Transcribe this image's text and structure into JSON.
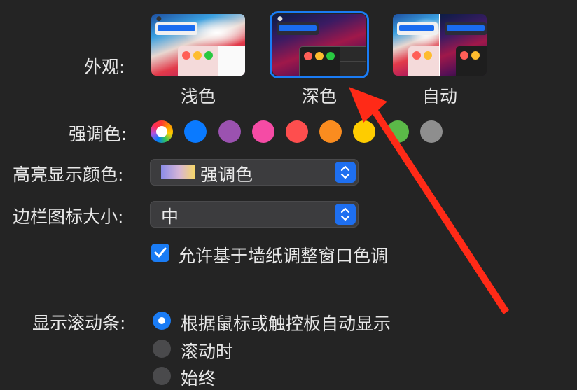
{
  "appearance": {
    "label": "外观:",
    "options": [
      {
        "label": "浅色",
        "selected": false
      },
      {
        "label": "深色",
        "selected": true
      },
      {
        "label": "自动",
        "selected": false
      }
    ]
  },
  "accent": {
    "label": "强调色:",
    "colors": [
      "multicolor",
      "#0a7aff",
      "#9b52b0",
      "#f54ba5",
      "#fe4e4e",
      "#fa8c1f",
      "#fecc00",
      "#5bb948",
      "#8e8e8e"
    ]
  },
  "highlight": {
    "label": "高亮显示颜色:",
    "value": "强调色"
  },
  "sidebar_icon_size": {
    "label": "边栏图标大小:",
    "value": "中"
  },
  "wallpaper_tint": {
    "label": "允许基于墙纸调整窗口色调",
    "checked": true
  },
  "scrollbars": {
    "label": "显示滚动条:",
    "options": [
      {
        "label": "根据鼠标或触控板自动显示",
        "selected": true
      },
      {
        "label": "滚动时",
        "selected": false
      },
      {
        "label": "始终",
        "selected": false
      }
    ]
  },
  "annotation": {
    "arrow_color": "#ff2a17"
  }
}
